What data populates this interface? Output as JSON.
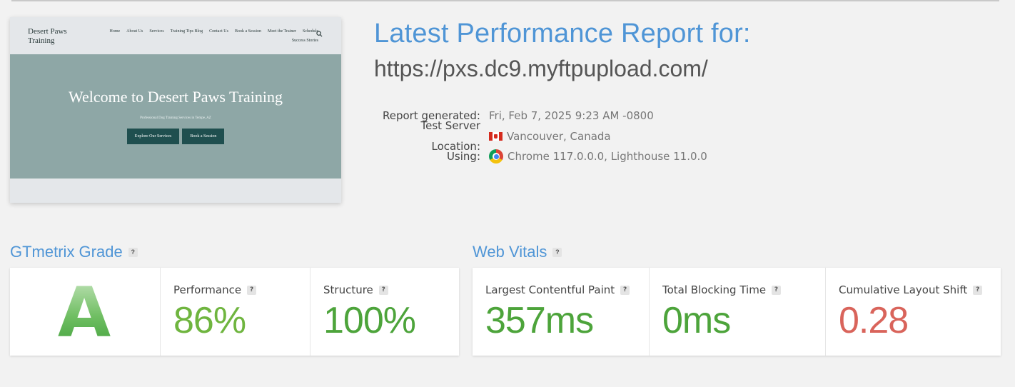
{
  "thumbnail": {
    "logo": "Desert Paws Training",
    "nav": [
      "Home",
      "About Us",
      "Services",
      "Training Tips Blog",
      "Contact Us",
      "Book a Session",
      "Meet the Trainer",
      "Schedule",
      "Success Stories"
    ],
    "search_icon": "search-icon",
    "hero_title": "Welcome to Desert Paws Training",
    "hero_subtitle": "Professional Dog Training Services in Tempe, AZ",
    "buttons": [
      "Explore Our Services",
      "Book a Session"
    ]
  },
  "report": {
    "title": "Latest Performance Report for:",
    "url": "https://pxs.dc9.myftpupload.com/",
    "meta": {
      "generated_label": "Report generated:",
      "generated_value": "Fri, Feb 7, 2025 9:23 AM -0800",
      "location_label": "Test Server Location:",
      "location_value": "Vancouver, Canada",
      "location_icon": "canada-flag-icon",
      "using_label": "Using:",
      "using_value": "Chrome 117.0.0.0, Lighthouse 11.0.0",
      "using_icon": "chrome-icon"
    }
  },
  "grade": {
    "title": "GTmetrix Grade",
    "help": "?",
    "letter": "A",
    "performance_label": "Performance",
    "performance_value": "86%",
    "structure_label": "Structure",
    "structure_value": "100%"
  },
  "vitals": {
    "title": "Web Vitals",
    "help": "?",
    "lcp_label": "Largest Contentful Paint",
    "lcp_value": "357ms",
    "tbt_label": "Total Blocking Time",
    "tbt_value": "0ms",
    "cls_label": "Cumulative Layout Shift",
    "cls_value": "0.28"
  },
  "colors": {
    "accent": "#4f95d6",
    "good": "#6fb53f",
    "great": "#4da43b",
    "bad": "#d9645b"
  }
}
